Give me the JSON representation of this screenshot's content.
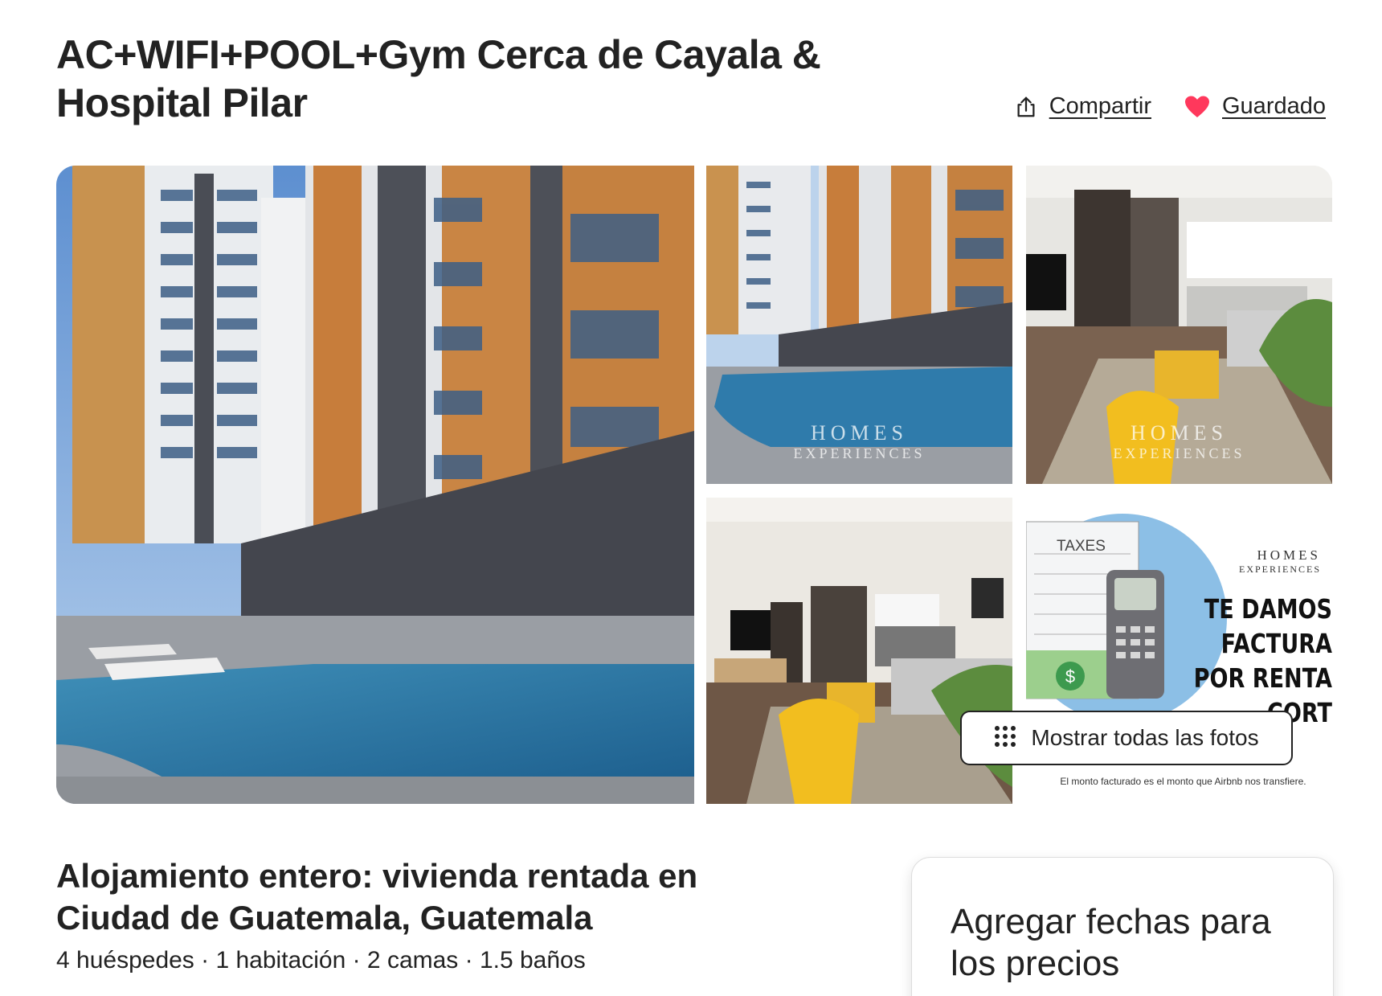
{
  "listing": {
    "title": "AC+WIFI+POOL+Gym Cerca de Cayala & Hospital Pilar"
  },
  "actions": {
    "share_label": "Compartir",
    "share_icon": "share-icon",
    "save_label": "Guardado",
    "save_icon": "heart-icon",
    "save_color": "#FF385C"
  },
  "gallery": {
    "watermark_line1": "HOMES",
    "watermark_line2": "EXPERIENCES",
    "promo": {
      "brand_line1": "HOMES",
      "brand_line2": "EXPERIENCES",
      "taxes_label": "TAXES",
      "headline": "TE DAMOS FACTURA POR RENTA CORT",
      "footnote": "El monto facturado es el monto que Airbnb nos transfiere."
    },
    "show_all_label": "Mostrar todas las fotos",
    "show_all_icon": "grid-dots-icon"
  },
  "summary": {
    "title": "Alojamiento entero: vivienda rentada en Ciudad de Guatemala, Guatemala",
    "details": "4 huéspedes · 1 habitación · 2 camas · 1.5 baños"
  },
  "booking": {
    "prompt": "Agregar fechas para los precios"
  }
}
